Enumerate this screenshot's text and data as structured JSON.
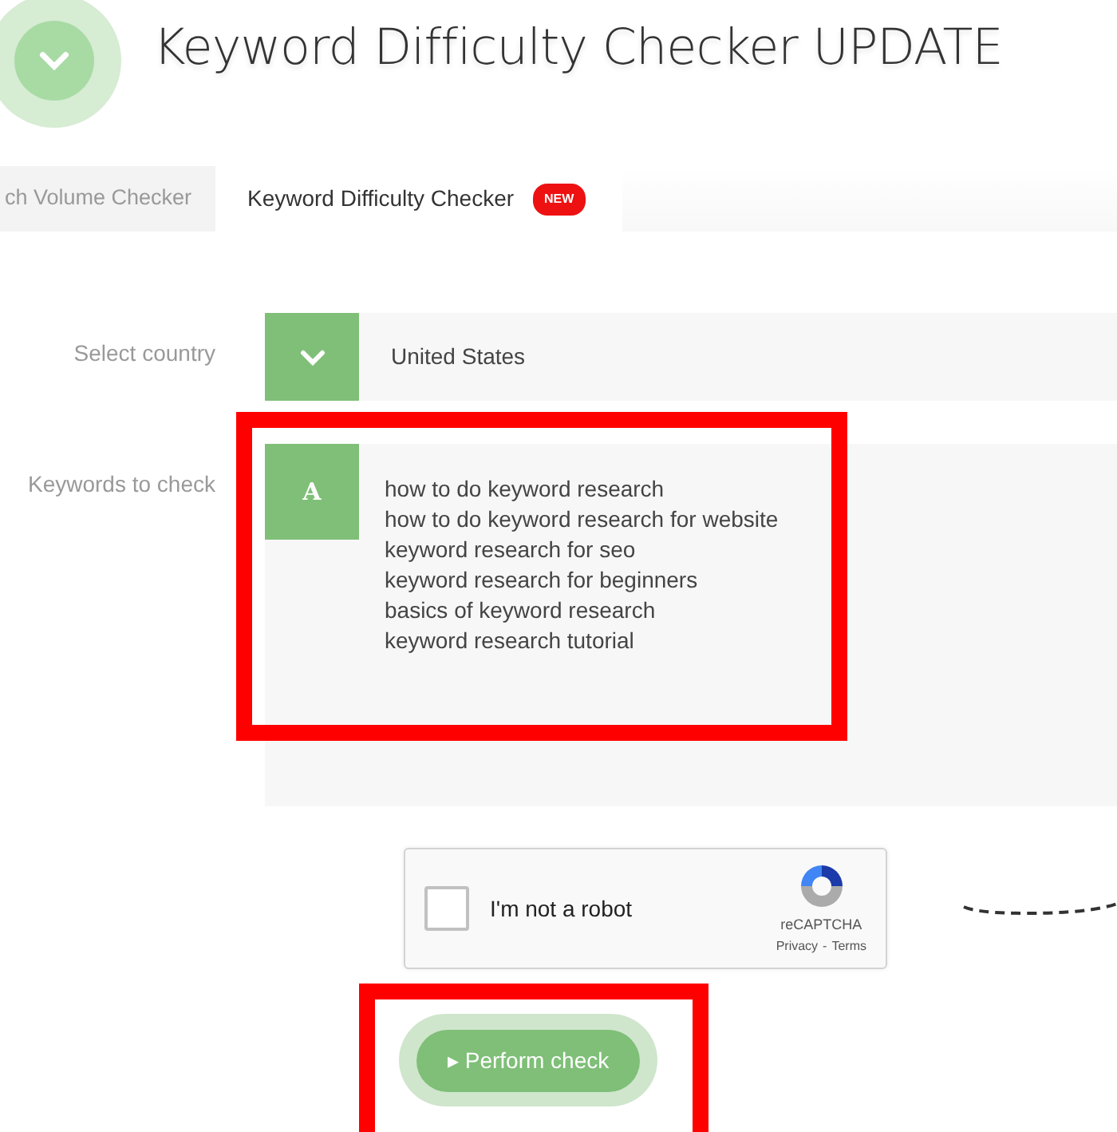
{
  "header": {
    "title": "Keyword Difficulty Checker UPDATE"
  },
  "tabs": [
    {
      "label": "ch Volume Checker",
      "selected": false
    },
    {
      "label": "Keyword Difficulty Checker",
      "selected": true,
      "badge": "NEW"
    }
  ],
  "form": {
    "country": {
      "label": "Select country",
      "value": "United States"
    },
    "keywords": {
      "label": "Keywords to check",
      "icon_letter": "A",
      "lines": [
        "how to do keyword research",
        "how to do keyword research for website",
        "keyword research for seo",
        "keyword research for beginners",
        "basics of keyword research",
        "keyword research tutorial"
      ]
    }
  },
  "captcha": {
    "label": "I'm not a robot",
    "checked": false,
    "brand": "reCAPTCHA",
    "privacy": "Privacy",
    "separator": "-",
    "terms": "Terms"
  },
  "submit": {
    "icon": "▸",
    "label": "Perform check"
  }
}
